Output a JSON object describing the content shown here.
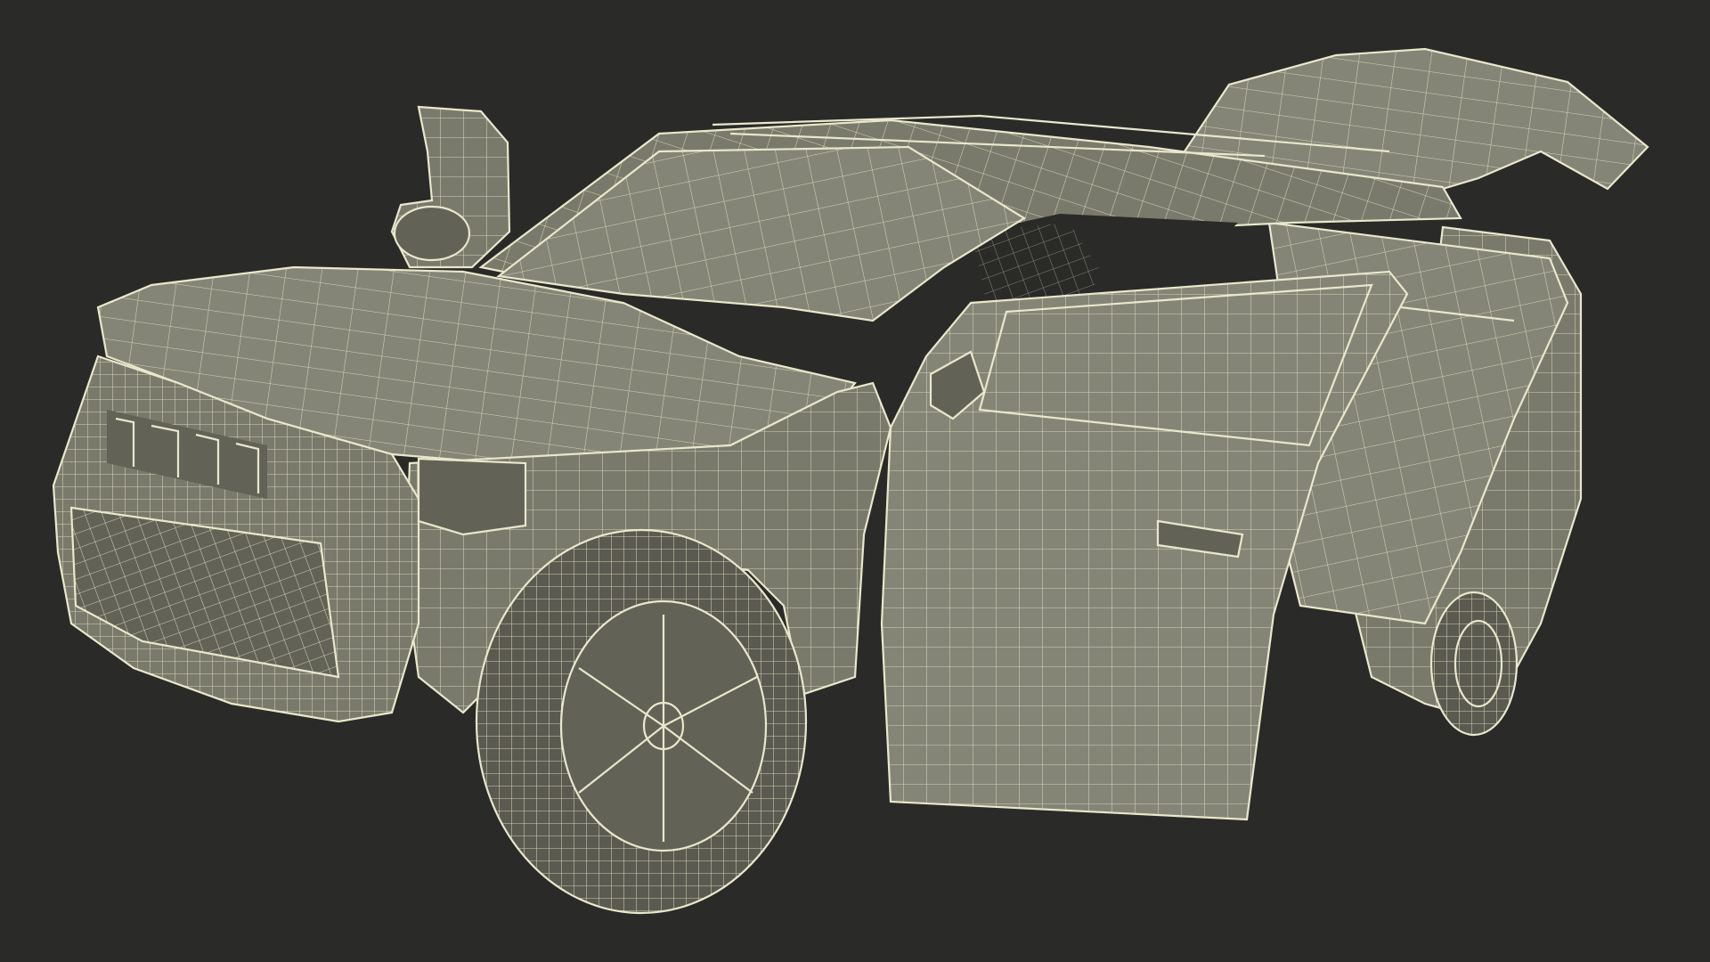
{
  "scene": {
    "subject": "suv-wireframe-model",
    "background_color": "#2a2a28",
    "surface_color": "#7a7a6c",
    "wire_color": "#e9e7cc",
    "parts": [
      "hood",
      "roof",
      "roof-rails",
      "windshield",
      "side-mirror",
      "front-bumper",
      "front-grille",
      "front-lettering",
      "headlight",
      "front-fender",
      "front-wheel",
      "front-door-open",
      "rear-door-open",
      "rear-wheel",
      "tailgate-open",
      "rear-quarter"
    ]
  }
}
